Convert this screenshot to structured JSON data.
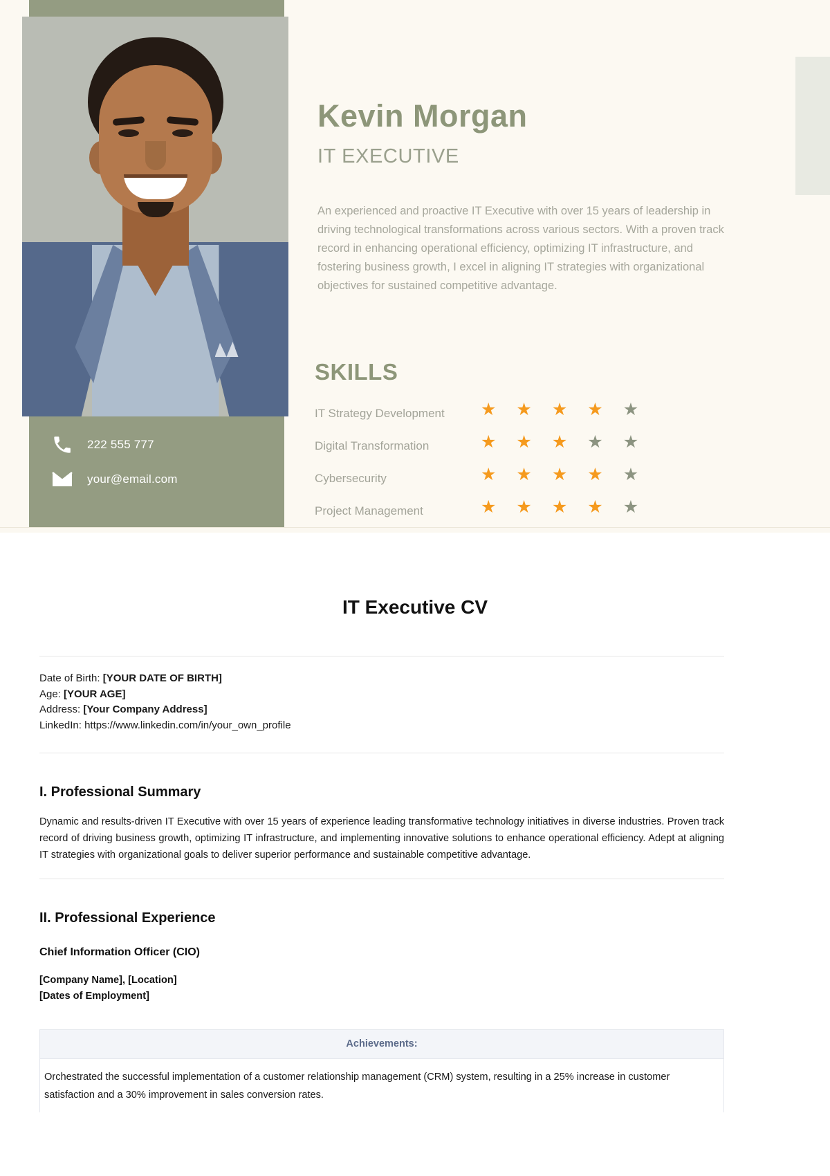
{
  "resume_card": {
    "name": "Kevin Morgan",
    "role": "IT EXECUTIVE",
    "profile": "An experienced and proactive IT Executive with over 15 years of leadership in driving technological transformations across various sectors. With a proven track record in enhancing operational efficiency, optimizing IT infrastructure, and fostering business growth, I excel in aligning IT strategies with organizational objectives for sustained competitive advantage.",
    "contact": {
      "phone": "222 555 777",
      "email": "your@email.com",
      "phone_icon": "phone-icon",
      "email_icon": "envelope-icon"
    },
    "skills_heading": "SKILLS",
    "skills": [
      {
        "label": "IT Strategy Development",
        "rating": 4,
        "max": 5
      },
      {
        "label": "Digital Transformation",
        "rating": 3,
        "max": 5
      },
      {
        "label": "Cybersecurity",
        "rating": 4,
        "max": 5
      },
      {
        "label": "Project Management",
        "rating": 4,
        "max": 5
      }
    ],
    "colors": {
      "card_bg": "#fcf9f2",
      "panel_green": "#949c82",
      "accent_block": "#e8eae2",
      "heading_green": "#8d9679",
      "star_on": "#f59a1e",
      "star_off": "#8c9481"
    }
  },
  "document": {
    "title": "IT Executive CV",
    "details": {
      "dob_label": "Date of Birth:",
      "dob_value": "[YOUR DATE OF BIRTH]",
      "age_label": "Age:",
      "age_value": "[YOUR AGE]",
      "address_label": "Address:",
      "address_value": "[Your Company Address]",
      "linkedin_label": "LinkedIn:",
      "linkedin_value": "https://www.linkedin.com/in/your_own_profile"
    },
    "section_summary": {
      "heading": "I. Professional Summary",
      "body": "Dynamic and results-driven IT Executive with over 15 years of experience leading transformative technology initiatives in diverse industries. Proven track record of driving business growth, optimizing IT infrastructure, and implementing innovative solutions to enhance operational efficiency. Adept at aligning IT strategies with organizational goals to deliver superior performance and sustainable competitive advantage."
    },
    "section_experience": {
      "heading": "II. Professional Experience",
      "job_title": "Chief Information Officer (CIO)",
      "company_line": "[Company Name], [Location]",
      "dates_line": "[Dates of Employment]",
      "achievements_header": "Achievements:",
      "achievement_1": "Orchestrated the successful implementation of a customer relationship management (CRM) system, resulting in a 25% increase in customer satisfaction and a 30% improvement in sales conversion rates."
    }
  }
}
